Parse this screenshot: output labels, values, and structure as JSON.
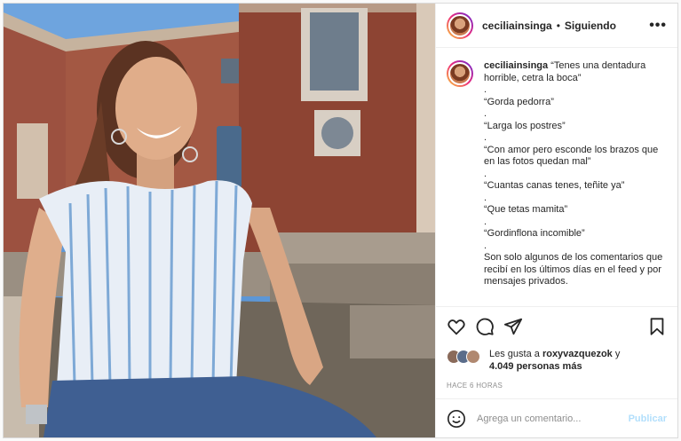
{
  "post": {
    "username": "ceciliainsinga",
    "separator": "•",
    "follow_status": "Siguiendo",
    "more_icon": "more-horizontal-icon",
    "caption_lines": [
      "“Tenes una dentadura horrible, cetra la boca”",
      ".",
      "“Gorda pedorra”",
      ".",
      "“Larga los postres”",
      ".",
      "“Con amor pero esconde los brazos que en las fotos quedan mal”",
      ".",
      "“Cuantas canas tenes, teñite ya”",
      ".",
      "“Que tetas mamita”",
      ".",
      "“Gordinflona incomible”",
      ".",
      "Son solo algunos de los comentarios que recibí en los últimos días en el feed y por mensajes privados."
    ],
    "likes_prefix": "Les gusta a",
    "likes_user": "roxyvazquezok",
    "likes_and": "y",
    "likes_count": "4.049 personas más",
    "timestamp": "HACE 6 HORAS",
    "comment_placeholder": "Agrega un comentario...",
    "publish_label": "Publicar"
  },
  "icons": {
    "like": "heart-icon",
    "comment": "comment-icon",
    "share": "send-icon",
    "save": "bookmark-icon",
    "emoji": "emoji-icon"
  },
  "colors": {
    "publish_disabled": "#b2dffc",
    "muted": "#8e8e8e",
    "border": "#dbdbdb"
  }
}
